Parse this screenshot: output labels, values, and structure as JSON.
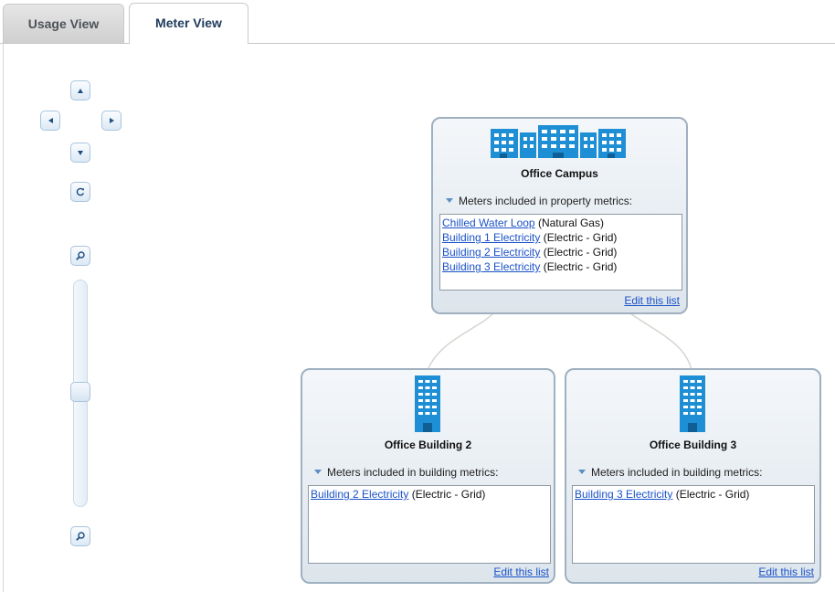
{
  "tabs": [
    {
      "label": "Usage View",
      "active": false
    },
    {
      "label": "Meter View",
      "active": true
    }
  ],
  "controls": {
    "pan_up": "pan-up",
    "pan_left": "pan-left",
    "pan_right": "pan-right",
    "pan_down": "pan-down",
    "reset": "refresh",
    "zoom_in": "zoom-in",
    "zoom_out": "zoom-out",
    "zoom_level": 0.5
  },
  "campus": {
    "title": "Office Campus",
    "icon": "building-group-icon",
    "meters_header": "Meters included in property metrics:",
    "meters": [
      {
        "name": "Chilled Water Loop",
        "type": "(Natural Gas)"
      },
      {
        "name": "Building 1 Electricity",
        "type": "(Electric - Grid)"
      },
      {
        "name": "Building 2 Electricity",
        "type": "(Electric - Grid)"
      },
      {
        "name": "Building 3 Electricity",
        "type": "(Electric - Grid)"
      }
    ],
    "edit_label": "Edit this list"
  },
  "building2": {
    "title": "Office Building 2",
    "icon": "building-icon",
    "meters_header": "Meters included in building metrics:",
    "meters": [
      {
        "name": "Building 2 Electricity",
        "type": "(Electric - Grid)"
      }
    ],
    "edit_label": "Edit this list"
  },
  "building3": {
    "title": "Office Building 3",
    "icon": "building-icon",
    "meters_header": "Meters included in building metrics:",
    "meters": [
      {
        "name": "Building 3 Electricity",
        "type": "(Electric - Grid)"
      }
    ],
    "edit_label": "Edit this list"
  },
  "colors": {
    "building_blue": "#1e8fd4",
    "link": "#1a52c8",
    "card_border": "#9fb0c0"
  }
}
